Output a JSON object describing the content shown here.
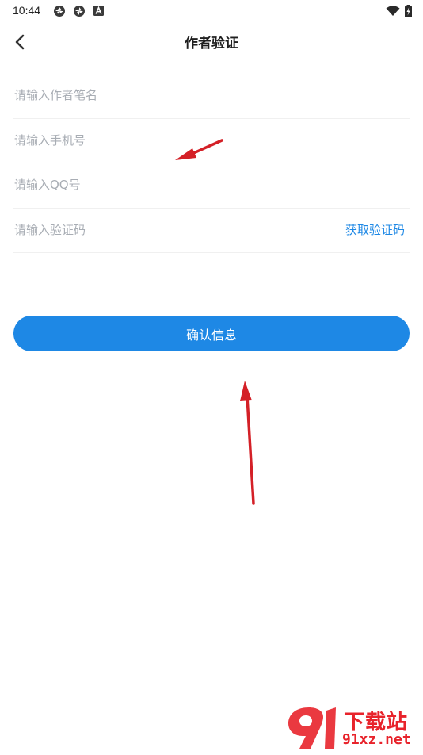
{
  "status_bar": {
    "time": "10:44",
    "icons_left": [
      "sync-icon",
      "sync-icon",
      "text-a-icon"
    ],
    "icons_right": [
      "wifi-icon",
      "battery-charging-icon"
    ]
  },
  "header": {
    "title": "作者验证",
    "back_icon": "chevron-left-icon"
  },
  "form": {
    "pen_name": {
      "value": "",
      "placeholder": "请输入作者笔名"
    },
    "phone": {
      "value": "",
      "placeholder": "请输入手机号"
    },
    "qq": {
      "value": "",
      "placeholder": "请输入QQ号"
    },
    "code": {
      "value": "",
      "placeholder": "请输入验证码"
    },
    "get_code_label": "获取验证码"
  },
  "confirm_label": "确认信息",
  "watermark": {
    "cn": "下载站",
    "en": "91xz.net"
  },
  "colors": {
    "accent": "#1e88e5",
    "placeholder": "#a8adb4",
    "divider": "#f0f0f0",
    "annotation": "#d42027",
    "watermark": "#e8232b"
  }
}
